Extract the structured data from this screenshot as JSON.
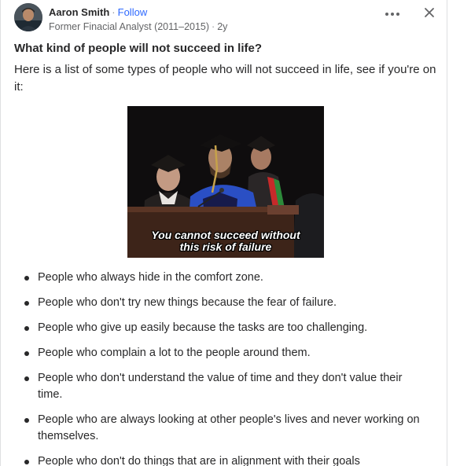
{
  "post": {
    "author": {
      "name": "Aaron Smith",
      "follow_label": "Follow",
      "credential": "Former Finacial Analyst (2011–2015)",
      "time_ago": "2y"
    },
    "separator": "·",
    "question": "What kind of people will not succeed in life?",
    "intro": "Here is a list of some types of people who will not succeed in life, see if you're on it:",
    "image": {
      "caption_line1": "You cannot succeed without",
      "caption_line2": "this risk of failure"
    },
    "list": [
      "People who always hide in the comfort zone.",
      "People who don't try new things because the fear of failure.",
      "People who give up easily because the tasks are too challenging.",
      "People who complain a lot to the people around them.",
      "People who don't understand the value of time and they don't value their time.",
      "People who are always looking at other people's lives and never working on themselves.",
      "People who don't do things that are in alignment with their goals"
    ]
  },
  "icons": {
    "more": "ellipsis-icon",
    "close": "close-icon"
  },
  "colors": {
    "link": "#2e69ff",
    "text": "#282829",
    "secondary": "#636466"
  }
}
